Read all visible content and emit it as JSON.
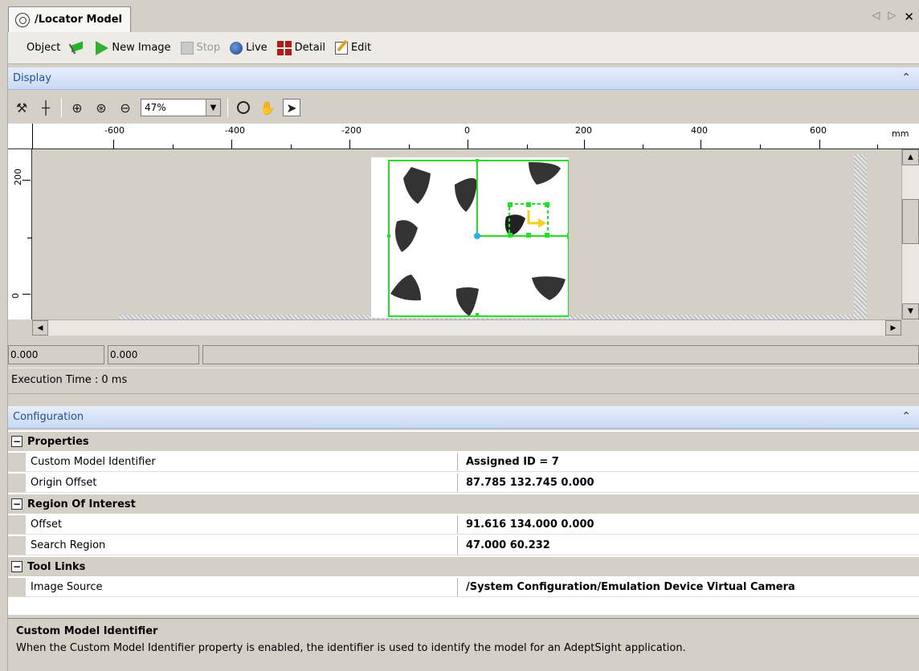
{
  "tab": {
    "title": "/Locator Model",
    "icon": "aperture-icon"
  },
  "tab_nav": {
    "prev": "◁",
    "next": "▷",
    "close": "✕"
  },
  "toolbar": {
    "object_label": "Object",
    "new_image_label": "New Image",
    "stop_label": "Stop",
    "live_label": "Live",
    "detail_label": "Detail",
    "edit_label": "Edit"
  },
  "display": {
    "title": "Display",
    "zoom_value": "47%",
    "collapse_glyph": "⌃"
  },
  "ruler": {
    "top_labels": [
      "-600",
      "-400",
      "-200",
      "0",
      "200",
      "400",
      "600",
      "mm"
    ],
    "left_labels": [
      "200",
      "0"
    ]
  },
  "coords": {
    "x": "0.000",
    "y": "0.000"
  },
  "execution_time": "Execution Time : 0 ms",
  "configuration": {
    "title": "Configuration",
    "categories": [
      {
        "name": "Properties",
        "rows": [
          {
            "name": "Custom Model Identifier",
            "value": "Assigned ID = 7"
          },
          {
            "name": "Origin Offset",
            "value": "87.785 132.745 0.000"
          }
        ]
      },
      {
        "name": "Region Of Interest",
        "rows": [
          {
            "name": "Offset",
            "value": "91.616 134.000 0.000"
          },
          {
            "name": "Search Region",
            "value": "47.000 60.232"
          }
        ]
      },
      {
        "name": "Tool Links",
        "rows": [
          {
            "name": "Image Source",
            "value": "/System Configuration/Emulation Device Virtual Camera"
          }
        ]
      }
    ]
  },
  "help": {
    "title": "Custom Model Identifier",
    "text": "When the Custom Model Identifier property is enabled, the identifier is used to identify the model for an AdeptSight application."
  },
  "colors": {
    "roi_green": "#22e022",
    "origin_cyan": "#2ab0f0",
    "header_blue": "#1f4e9c"
  }
}
